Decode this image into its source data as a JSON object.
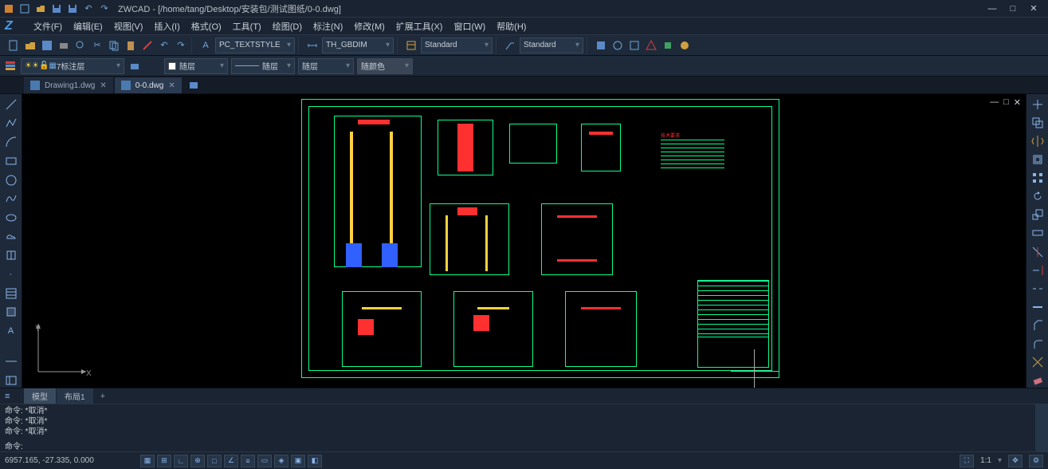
{
  "app": {
    "name": "ZWCAD",
    "title_path": "[/home/tang/Desktop/安装包/测试图纸/0-0.dwg]"
  },
  "menus": [
    "文件(F)",
    "编辑(E)",
    "视图(V)",
    "插入(I)",
    "格式(O)",
    "工具(T)",
    "绘图(D)",
    "标注(N)",
    "修改(M)",
    "扩展工具(X)",
    "窗口(W)",
    "帮助(H)"
  ],
  "ribbon": {
    "textstyle": "PC_TEXTSTYLE",
    "dimstyle": "TH_GBDIM",
    "tablestyle": "Standard",
    "mleaderstyle": "Standard"
  },
  "layerbar": {
    "current_layer": "7标注层",
    "linetype1": "随层",
    "linetype2": "随层",
    "lineweight": "随层",
    "color": "随颜色"
  },
  "tabs": [
    {
      "label": "Drawing1.dwg",
      "active": false
    },
    {
      "label": "0-0.dwg",
      "active": true
    }
  ],
  "layout_tabs": {
    "model": "模型",
    "layout1": "布局1"
  },
  "command": {
    "history": [
      "命令: *取消*",
      "命令: *取消*",
      "命令: *取消*"
    ],
    "prompt": "命令:"
  },
  "status": {
    "coords": "6957.165, -27.335, 0.000",
    "scale": "1:1"
  },
  "ucs": {
    "x": "X",
    "y": "Y"
  }
}
